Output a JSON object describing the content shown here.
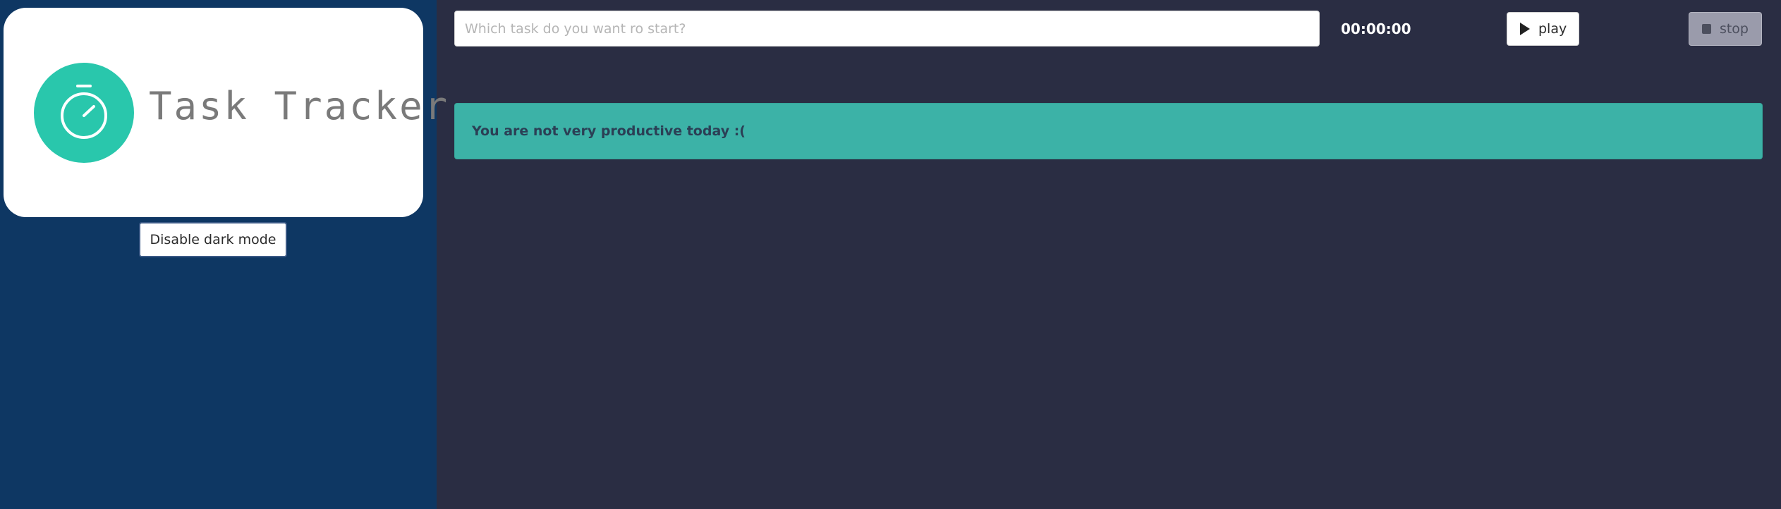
{
  "app": {
    "title": "Task Tracker"
  },
  "sidebar": {
    "logo_icon": "stopwatch-icon",
    "dark_mode_toggle_label": "Disable dark mode"
  },
  "toolbar": {
    "task_input_placeholder": "Which task do you want ro start?",
    "task_input_value": "",
    "timer_text": "00:00:00",
    "play_label": "play",
    "play_icon": "play-icon",
    "stop_label": "stop",
    "stop_icon": "stop-icon",
    "stop_disabled": true
  },
  "main": {
    "productivity_message": "You are not very productive today :("
  },
  "colors": {
    "sidebar_bg": "#0e3763",
    "main_bg": "#2a2d43",
    "accent": "#29c7ac",
    "alert_bg": "#3cb2a7"
  }
}
